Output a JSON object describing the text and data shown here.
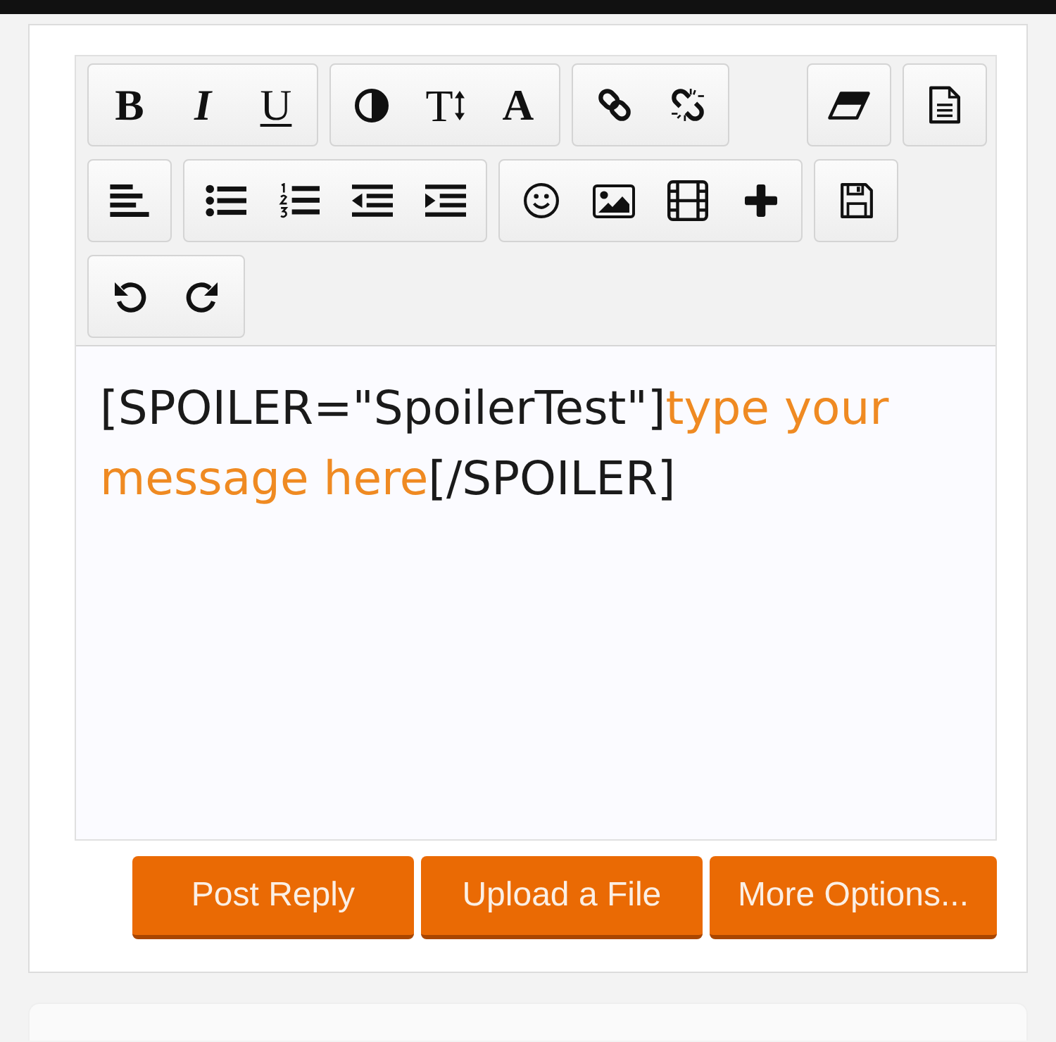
{
  "editor": {
    "toolbar": {
      "rows": [
        {
          "groups": [
            {
              "buttons": [
                {
                  "kind": "bold",
                  "glyph": "B"
                },
                {
                  "kind": "italic",
                  "glyph": "I"
                },
                {
                  "kind": "underline",
                  "glyph": "U"
                }
              ]
            },
            {
              "buttons": [
                {
                  "kind": "contrast"
                },
                {
                  "kind": "textsize",
                  "glyph": "T"
                },
                {
                  "kind": "font",
                  "glyph": "A"
                }
              ]
            },
            {
              "buttons": [
                {
                  "kind": "link"
                },
                {
                  "kind": "unlink"
                }
              ]
            }
          ],
          "right_groups": [
            {
              "buttons": [
                {
                  "kind": "eraser"
                }
              ]
            },
            {
              "buttons": [
                {
                  "kind": "document"
                }
              ]
            }
          ]
        },
        {
          "groups": [
            {
              "buttons": [
                {
                  "kind": "alignleft"
                }
              ]
            },
            {
              "buttons": [
                {
                  "kind": "bulletlist"
                },
                {
                  "kind": "numberlist"
                },
                {
                  "kind": "outdent"
                },
                {
                  "kind": "indent"
                }
              ]
            },
            {
              "buttons": [
                {
                  "kind": "smiley"
                },
                {
                  "kind": "image"
                },
                {
                  "kind": "film"
                },
                {
                  "kind": "plus"
                }
              ]
            },
            {
              "buttons": [
                {
                  "kind": "save"
                }
              ]
            }
          ]
        },
        {
          "groups": [
            {
              "buttons": [
                {
                  "kind": "undo"
                },
                {
                  "kind": "redo"
                }
              ]
            }
          ]
        }
      ]
    },
    "message": [
      {
        "text": "[SPOILER=\"SpoilerTest\"]",
        "color": "#1a1a1a"
      },
      {
        "text": "type your message here",
        "color": "#ef8a22"
      },
      {
        "text": "[/SPOILER]",
        "color": "#1a1a1a"
      }
    ]
  },
  "actions": [
    {
      "label": "Post Reply"
    },
    {
      "label": "Upload a File"
    },
    {
      "label": "More Options..."
    }
  ]
}
